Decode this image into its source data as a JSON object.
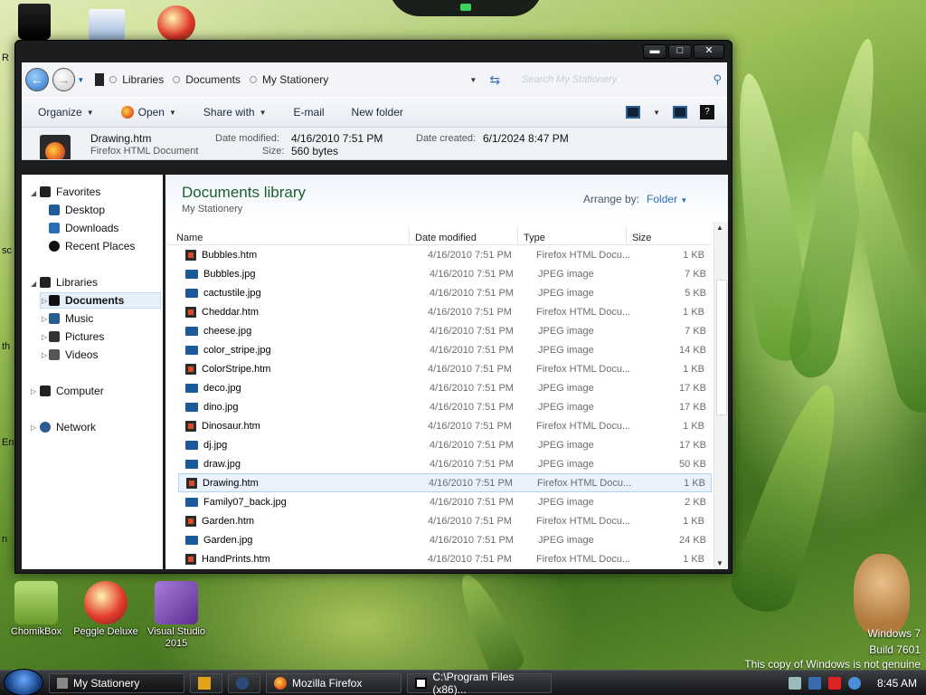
{
  "desktop": {
    "top_icons": [
      {
        "name": "Recycle Bin"
      },
      {
        "name": "Stationery"
      },
      {
        "name": "Peggle"
      }
    ],
    "bottom_icons": [
      {
        "label": "ChomikBox"
      },
      {
        "label": "Peggle Deluxe"
      },
      {
        "label": "Visual Studio 2015"
      }
    ],
    "edge_letters": [
      "R",
      "sc",
      "th",
      "En",
      "n"
    ],
    "watermark": {
      "line1": "Windows 7",
      "line2": "Build 7601",
      "line3": "This copy of Windows is not genuine"
    }
  },
  "window": {
    "caption_buttons": {
      "min": "▬",
      "max": "□",
      "close": "✕"
    },
    "breadcrumb": [
      "Libraries",
      "Documents",
      "My Stationery"
    ],
    "search_placeholder": "Search My Stationery",
    "toolbar": {
      "organize": "Organize",
      "open": "Open",
      "share_with": "Share with",
      "email": "E-mail",
      "new_folder": "New folder"
    },
    "details": {
      "file_name": "Drawing.htm",
      "file_type": "Firefox HTML Document",
      "date_modified_label": "Date modified:",
      "date_modified": "4/16/2010 7:51 PM",
      "date_created_label": "Date created:",
      "date_created": "6/1/2024 8:47 PM",
      "size_label": "Size:",
      "size": "560 bytes"
    },
    "nav": {
      "favorites": "Favorites",
      "desktop": "Desktop",
      "downloads": "Downloads",
      "recent_places": "Recent Places",
      "libraries": "Libraries",
      "documents": "Documents",
      "music": "Music",
      "pictures": "Pictures",
      "videos": "Videos",
      "computer": "Computer",
      "network": "Network"
    },
    "main": {
      "library_title": "Documents library",
      "library_subtitle": "My Stationery",
      "arrange_label": "Arrange by:",
      "arrange_value": "Folder",
      "columns": {
        "name": "Name",
        "date": "Date modified",
        "type": "Type",
        "size": "Size"
      },
      "files": [
        {
          "name": "Bubbles.htm",
          "date": "4/16/2010 7:51 PM",
          "type": "Firefox HTML Docu...",
          "size": "1 KB",
          "kind": "htm"
        },
        {
          "name": "Bubbles.jpg",
          "date": "4/16/2010 7:51 PM",
          "type": "JPEG image",
          "size": "7 KB",
          "kind": "jpg"
        },
        {
          "name": "cactustile.jpg",
          "date": "4/16/2010 7:51 PM",
          "type": "JPEG image",
          "size": "5 KB",
          "kind": "jpg"
        },
        {
          "name": "Cheddar.htm",
          "date": "4/16/2010 7:51 PM",
          "type": "Firefox HTML Docu...",
          "size": "1 KB",
          "kind": "htm"
        },
        {
          "name": "cheese.jpg",
          "date": "4/16/2010 7:51 PM",
          "type": "JPEG image",
          "size": "7 KB",
          "kind": "jpg"
        },
        {
          "name": "color_stripe.jpg",
          "date": "4/16/2010 7:51 PM",
          "type": "JPEG image",
          "size": "14 KB",
          "kind": "jpg"
        },
        {
          "name": "ColorStripe.htm",
          "date": "4/16/2010 7:51 PM",
          "type": "Firefox HTML Docu...",
          "size": "1 KB",
          "kind": "htm"
        },
        {
          "name": "deco.jpg",
          "date": "4/16/2010 7:51 PM",
          "type": "JPEG image",
          "size": "17 KB",
          "kind": "jpg"
        },
        {
          "name": "dino.jpg",
          "date": "4/16/2010 7:51 PM",
          "type": "JPEG image",
          "size": "17 KB",
          "kind": "jpg"
        },
        {
          "name": "Dinosaur.htm",
          "date": "4/16/2010 7:51 PM",
          "type": "Firefox HTML Docu...",
          "size": "1 KB",
          "kind": "htm"
        },
        {
          "name": "dj.jpg",
          "date": "4/16/2010 7:51 PM",
          "type": "JPEG image",
          "size": "17 KB",
          "kind": "jpg"
        },
        {
          "name": "draw.jpg",
          "date": "4/16/2010 7:51 PM",
          "type": "JPEG image",
          "size": "50 KB",
          "kind": "jpg"
        },
        {
          "name": "Drawing.htm",
          "date": "4/16/2010 7:51 PM",
          "type": "Firefox HTML Docu...",
          "size": "1 KB",
          "kind": "htm",
          "selected": true
        },
        {
          "name": "Family07_back.jpg",
          "date": "4/16/2010 7:51 PM",
          "type": "JPEG image",
          "size": "2 KB",
          "kind": "jpg"
        },
        {
          "name": "Garden.htm",
          "date": "4/16/2010 7:51 PM",
          "type": "Firefox HTML Docu...",
          "size": "1 KB",
          "kind": "htm"
        },
        {
          "name": "Garden.jpg",
          "date": "4/16/2010 7:51 PM",
          "type": "JPEG image",
          "size": "24 KB",
          "kind": "jpg"
        },
        {
          "name": "HandPrints.htm",
          "date": "4/16/2010 7:51 PM",
          "type": "Firefox HTML Docu...",
          "size": "1 KB",
          "kind": "htm"
        }
      ]
    }
  },
  "taskbar": {
    "items": [
      {
        "label": "My Stationery"
      },
      {
        "label": ""
      },
      {
        "label": ""
      },
      {
        "label": "Mozilla Firefox"
      },
      {
        "label": "C:\\Program Files (x86)..."
      }
    ],
    "clock": "8:45 AM"
  }
}
